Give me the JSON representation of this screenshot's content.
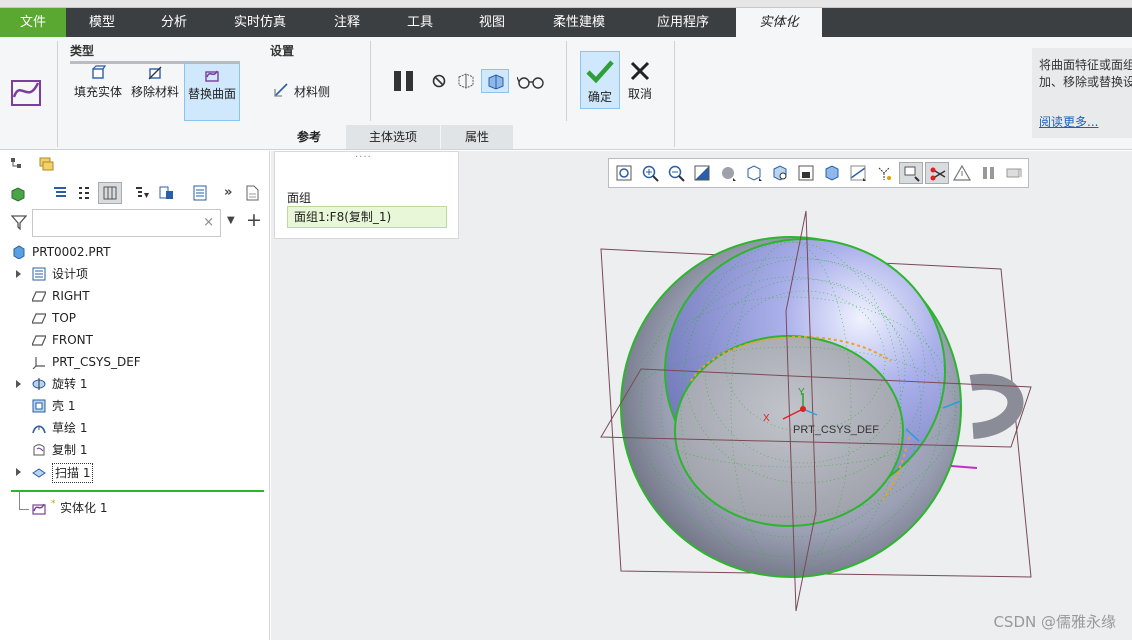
{
  "tabs": [
    "文件",
    "模型",
    "分析",
    "实时仿真",
    "注释",
    "工具",
    "视图",
    "柔性建模",
    "应用程序",
    "实体化"
  ],
  "ribbon": {
    "group_type": "类型",
    "group_settings": "设置",
    "btn_fill": "填充实体",
    "btn_remove": "移除材料",
    "btn_replace": "替换曲面",
    "btn_material_side": "材料侧",
    "btn_ok": "确定",
    "btn_cancel": "取消",
    "subtab_ref": "参考",
    "subtab_body": "主体选项",
    "subtab_props": "属性"
  },
  "help": {
    "line1": "将曲面特征或面组",
    "line2": "加、移除或替换设",
    "link": "阅读更多..."
  },
  "refpanel": {
    "handle": "····",
    "label": "面组",
    "value": "面组1:F8(复制_1)"
  },
  "tree": {
    "root": "PRT0002.PRT",
    "items": [
      "设计项",
      "RIGHT",
      "TOP",
      "FRONT",
      "PRT_CSYS_DEF",
      "旋转 1",
      "壳 1",
      "草绘 1",
      "复制 1",
      "扫描 1"
    ],
    "new_feature": "实体化 1",
    "new_marker": "*"
  },
  "model": {
    "csys_label": "PRT_CSYS_DEF",
    "axis_x": "X",
    "axis_y": "Y"
  },
  "colors": {
    "file_tab": "#5aa832",
    "selection_green": "#2db52d",
    "datum_plane": "#7a4a55",
    "surface_blue": "#9aa2e0"
  },
  "watermark": "CSDN @儒雅永缘"
}
